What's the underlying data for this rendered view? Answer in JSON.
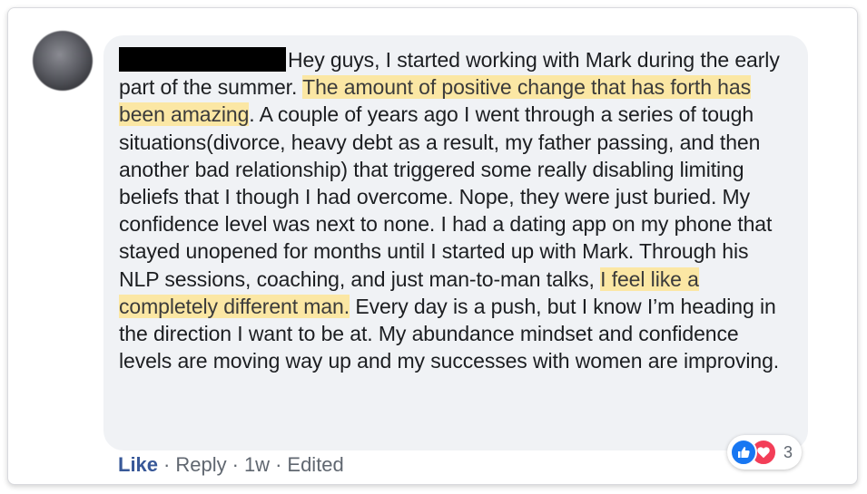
{
  "comment": {
    "segments": [
      {
        "type": "redacted"
      },
      {
        "type": "text",
        "text": "Hey guys, I started working with Mark during the early part of the summer. "
      },
      {
        "type": "highlight",
        "text": "The amount of positive change that has forth has been amazing"
      },
      {
        "type": "text",
        "text": ". A couple of years ago I went through a series of tough situations(divorce, heavy debt as a result, my father passing, and then another bad relationship) that triggered some really disabling limiting beliefs that I though I had overcome. Nope, they were just buried. My confidence level was next to none. I had a dating app on my phone that stayed unopened for months until I started up with Mark. Through his NLP sessions, coaching, and just man-to-man talks, "
      },
      {
        "type": "highlight",
        "text": "I feel like a completely different man."
      },
      {
        "type": "text",
        "text": " Every day is a push, but I know I’m heading in the direction I want to be at. My abundance mindset and confidence levels are moving way up and my successes with women are improving."
      }
    ],
    "highlight_color": "#fbe7a4",
    "bubble_color": "#f0f2f5"
  },
  "actions": {
    "like_label": "Like",
    "reply_label": "Reply",
    "time_label": "1w",
    "edited_label": "Edited",
    "separator": "·",
    "link_color": "#385898"
  },
  "reactions": {
    "icons": [
      "thumbs-up-icon",
      "heart-icon"
    ],
    "count": "3",
    "like_color": "#1877f2",
    "love_color": "#f33e58"
  }
}
